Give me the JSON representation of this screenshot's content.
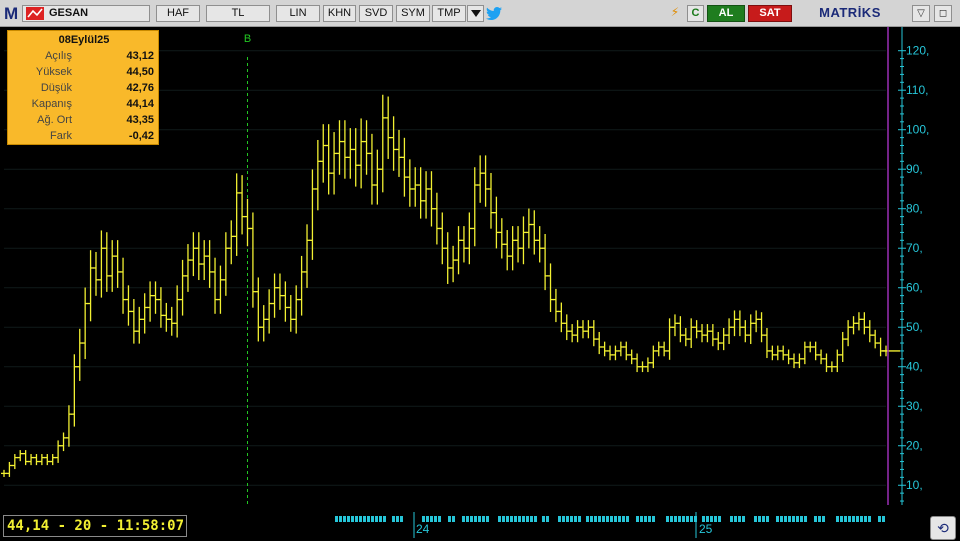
{
  "toolbar": {
    "logo": "M",
    "symbol": "GESAN",
    "buttons": [
      "HAF",
      "TL",
      "LIN",
      "KHN",
      "SVD",
      "SYM",
      "TMP"
    ],
    "dropdown_icon": "triangle-down-icon",
    "twitter_icon": "twitter-bird-icon",
    "bolt_icon": "lightning-icon",
    "c_label": "C",
    "al_label": "AL",
    "sat_label": "SAT",
    "brand": "MATRİKS",
    "window_controls": [
      "▽",
      "◻"
    ],
    "colors": {
      "al": "#1f7d1f",
      "sat": "#c71b1b",
      "brand": "#1b2a78"
    }
  },
  "info_box": {
    "title": "08Eylül25",
    "rows": [
      {
        "label": "Açılış",
        "value": "43,12"
      },
      {
        "label": "Yüksek",
        "value": "44,50"
      },
      {
        "label": "Düşük",
        "value": "42,76"
      },
      {
        "label": "Kapanış",
        "value": "44,14"
      },
      {
        "label": "Ağ. Ort",
        "value": "43,35"
      },
      {
        "label": "Fark",
        "value": "-0,42"
      }
    ]
  },
  "readout": "44,14 - 20 - 11:58:07",
  "corner_icon": "refresh-icon",
  "chart_data": {
    "type": "ohlc-bar",
    "series_color": "#f2f032",
    "axis_color": "#26c6d9",
    "y_axis": {
      "side": "right",
      "range": [
        5,
        126
      ],
      "ticks": [
        10,
        20,
        30,
        40,
        50,
        60,
        70,
        80,
        90,
        100,
        110,
        120
      ],
      "tick_format": "N,"
    },
    "x_axis": {
      "labels": [
        {
          "text": "24",
          "position_index": 90
        },
        {
          "text": "25",
          "position_index": 155
        }
      ]
    },
    "marker": {
      "label": "B",
      "position_index": 45,
      "color": "#22c722"
    },
    "grid": true,
    "closes": [
      13,
      15,
      17,
      18,
      16,
      17,
      16,
      17,
      16,
      17,
      20,
      22,
      28,
      40,
      46,
      56,
      65,
      62,
      70,
      63,
      68,
      64,
      57,
      54,
      49,
      52,
      55,
      58,
      57,
      53,
      52,
      51,
      57,
      63,
      67,
      70,
      66,
      68,
      64,
      57,
      62,
      70,
      73,
      84,
      78,
      75,
      59,
      50,
      52,
      56,
      60,
      58,
      55,
      52,
      57,
      64,
      72,
      85,
      92,
      96,
      89,
      94,
      97,
      93,
      95,
      91,
      97,
      94,
      86,
      90,
      103,
      98,
      95,
      93,
      88,
      85,
      86,
      82,
      85,
      80,
      75,
      70,
      65,
      67,
      72,
      70,
      75,
      86,
      89,
      85,
      79,
      74,
      71,
      68,
      72,
      70,
      74,
      76,
      72,
      70,
      63,
      57,
      54,
      51,
      49,
      48,
      50,
      49,
      50,
      47,
      45,
      44,
      43,
      44,
      45,
      43,
      42,
      40,
      40,
      41,
      44,
      45,
      44,
      50,
      51,
      48,
      47,
      50,
      49,
      48,
      49,
      47,
      46,
      48,
      50,
      52,
      50,
      48,
      51,
      52,
      48,
      44,
      43,
      44,
      43,
      42,
      41,
      42,
      45,
      45,
      43,
      42,
      40,
      40,
      43,
      47,
      50,
      51,
      52,
      50,
      48,
      46,
      44,
      44
    ],
    "spreads": [
      2,
      2,
      2,
      2,
      2,
      2,
      2,
      2,
      2,
      2,
      3,
      3,
      5,
      7,
      8,
      9,
      10,
      9,
      10,
      9,
      9,
      9,
      8,
      8,
      7,
      7,
      8,
      8,
      8,
      7,
      7,
      7,
      8,
      9,
      9,
      9,
      9,
      9,
      9,
      8,
      8,
      9,
      9,
      11,
      10,
      10,
      9,
      8,
      8,
      8,
      8,
      8,
      8,
      7,
      8,
      9,
      9,
      11,
      12,
      12,
      12,
      12,
      12,
      12,
      12,
      12,
      13,
      12,
      11,
      11,
      13,
      12,
      12,
      11,
      11,
      10,
      10,
      10,
      10,
      10,
      9,
      9,
      9,
      8,
      8,
      8,
      9,
      10,
      10,
      10,
      9,
      9,
      8,
      8,
      8,
      8,
      9,
      9,
      8,
      8,
      8,
      7,
      6,
      5,
      5,
      4,
      4,
      4,
      4,
      4,
      4,
      3,
      3,
      3,
      3,
      3,
      3,
      3,
      3,
      3,
      3,
      3,
      3,
      5,
      5,
      4,
      4,
      5,
      4,
      4,
      4,
      4,
      4,
      4,
      5,
      5,
      5,
      4,
      5,
      5,
      4,
      4,
      3,
      3,
      3,
      3,
      3,
      3,
      3,
      3,
      3,
      3,
      3,
      3,
      3,
      4,
      4,
      4,
      4,
      4,
      4,
      3,
      3,
      3
    ]
  },
  "timeline_blocks": 19
}
